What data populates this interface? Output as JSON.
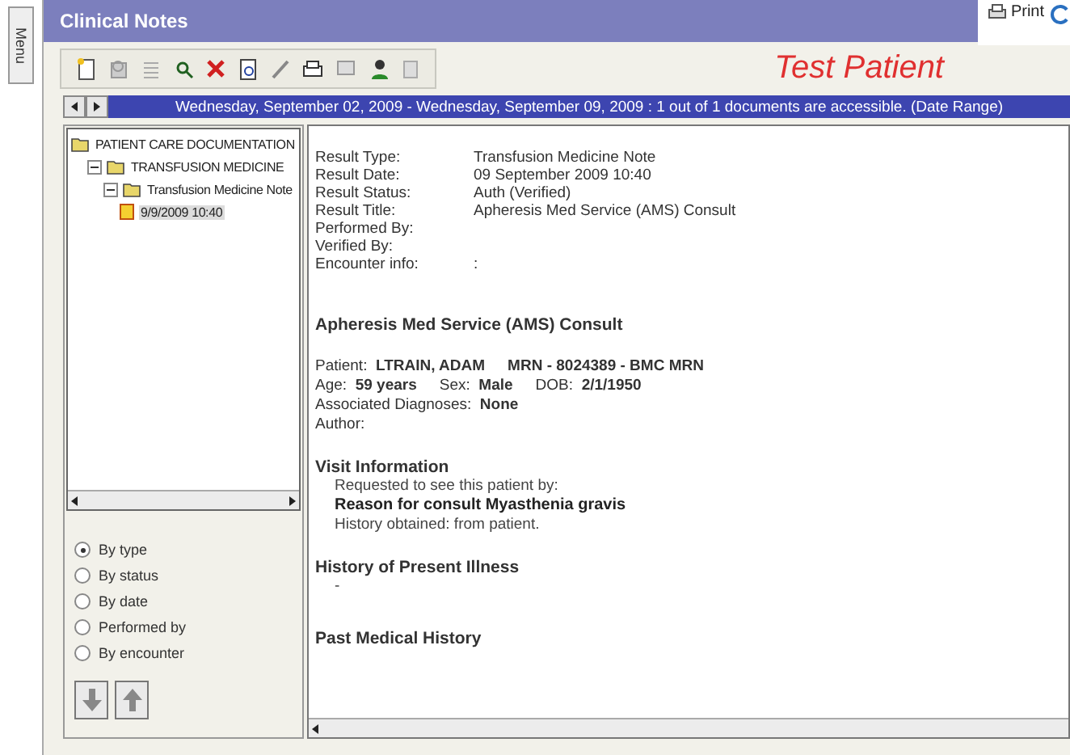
{
  "window": {
    "title": "Clinical Notes",
    "side_tab": "Menu"
  },
  "header_actions": [
    {
      "label": "Print"
    }
  ],
  "toolbar": {
    "patient": "Test Patient"
  },
  "date_bar": {
    "text": "Wednesday, September 02, 2009 - Wednesday, September 09, 2009 : 1 out of 1 documents are accessible. (Date Range)"
  },
  "tree": [
    {
      "label": "PATIENT CARE DOCUMENTATION",
      "children": [
        {
          "label": "TRANSFUSION MEDICINE",
          "expanded": true,
          "children": [
            {
              "label": "Transfusion Medicine Note",
              "expanded": true,
              "children": [
                {
                  "label": "9/9/2009 10:40",
                  "selected": true
                }
              ]
            }
          ]
        }
      ]
    }
  ],
  "sort_options": [
    {
      "label": "By type",
      "selected": true
    },
    {
      "label": "By status",
      "selected": false
    },
    {
      "label": "By date",
      "selected": false
    },
    {
      "label": "Performed by",
      "selected": false
    },
    {
      "label": "By encounter",
      "selected": false
    }
  ],
  "document": {
    "fields": [
      {
        "label": "Result Type:",
        "value": "Transfusion Medicine Note"
      },
      {
        "label": "Result Date:",
        "value": "09 September 2009 10:40"
      },
      {
        "label": "Result Status:",
        "value": "Auth (Verified)"
      },
      {
        "label": "Result Title:",
        "value": "Apheresis Med Service (AMS) Consult"
      },
      {
        "label": "Performed By:"
      },
      {
        "label": "Verified By:"
      },
      {
        "label": "Encounter info:",
        "value": ":"
      }
    ],
    "title": "Apheresis Med Service (AMS) Consult",
    "patient_lines": [
      {
        "parts": [
          "Patient:  **LTRAIN, ADAM**",
          "**MRN - 8024389 - BMC MRN**"
        ]
      },
      {
        "parts": [
          "Age:  **59 years**",
          "Sex:  **Male**",
          "DOB:  **2/1/1950**"
        ]
      },
      {
        "parts": [
          "Associated Diagnoses:  **None**"
        ]
      },
      {
        "parts": [
          "Author:"
        ]
      }
    ],
    "sections": [
      {
        "heading": "Visit Information",
        "lines": [
          {
            "text": "Requested to see this patient by:",
            "bold": false
          },
          {
            "text": "Reason for consult  Myasthenia gravis",
            "bold": true
          },
          {
            "text": "History obtained: from patient.",
            "bold": false
          }
        ]
      },
      {
        "heading": "History of Present Illness",
        "lines": [
          {
            "text": "-",
            "bold": false
          }
        ]
      },
      {
        "heading": "Past Medical History"
      }
    ]
  }
}
